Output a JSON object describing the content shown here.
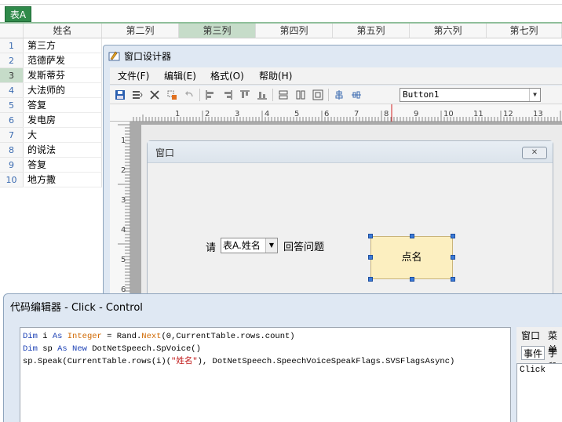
{
  "sheet": {
    "tab": "表A",
    "columns": [
      "姓名",
      "第二列",
      "第三列",
      "第四列",
      "第五列",
      "第六列",
      "第七列"
    ],
    "selected_column": "第三列",
    "rows": [
      {
        "num": "1",
        "name": "第三方"
      },
      {
        "num": "2",
        "name": "范德萨发"
      },
      {
        "num": "3",
        "name": "发斯蒂芬"
      },
      {
        "num": "4",
        "name": "大法师的"
      },
      {
        "num": "5",
        "name": "答复"
      },
      {
        "num": "6",
        "name": "发电房"
      },
      {
        "num": "7",
        "name": "大"
      },
      {
        "num": "8",
        "name": "的说法"
      },
      {
        "num": "9",
        "name": "答复"
      },
      {
        "num": "10",
        "name": "地方撒"
      }
    ],
    "selected_row": "3"
  },
  "designer": {
    "title": "窗口设计器",
    "menu": [
      "文件(F)",
      "编辑(E)",
      "格式(O)",
      "帮助(H)"
    ],
    "control_select": "Button1",
    "ruler_h": [
      "1",
      "2",
      "3",
      "4",
      "5",
      "6",
      "7",
      "8",
      "9",
      "10",
      "11",
      "12",
      "13"
    ],
    "ruler_v": [
      "1",
      "2",
      "3",
      "4",
      "5",
      "6"
    ],
    "form": {
      "title": "窗口",
      "label_qing": "请",
      "combo_value": "表A.姓名",
      "label_answer": "回答问题",
      "button_label": "点名"
    }
  },
  "code_editor": {
    "title": "代码编辑器 - Click - Control",
    "right_tabs": [
      "窗口",
      "菜单"
    ],
    "right_subtabs": [
      "事件",
      "字段"
    ],
    "event_list": [
      "Click"
    ]
  },
  "colors": {
    "sheet_tab": "#2f8a4a",
    "selected_header": "#c6dcc9",
    "keyword": "#1a3fb4",
    "type_keyword": "#d06800",
    "string": "#c01818",
    "button_fill": "#fcefc0",
    "selection_handle": "#3a7ad8"
  }
}
